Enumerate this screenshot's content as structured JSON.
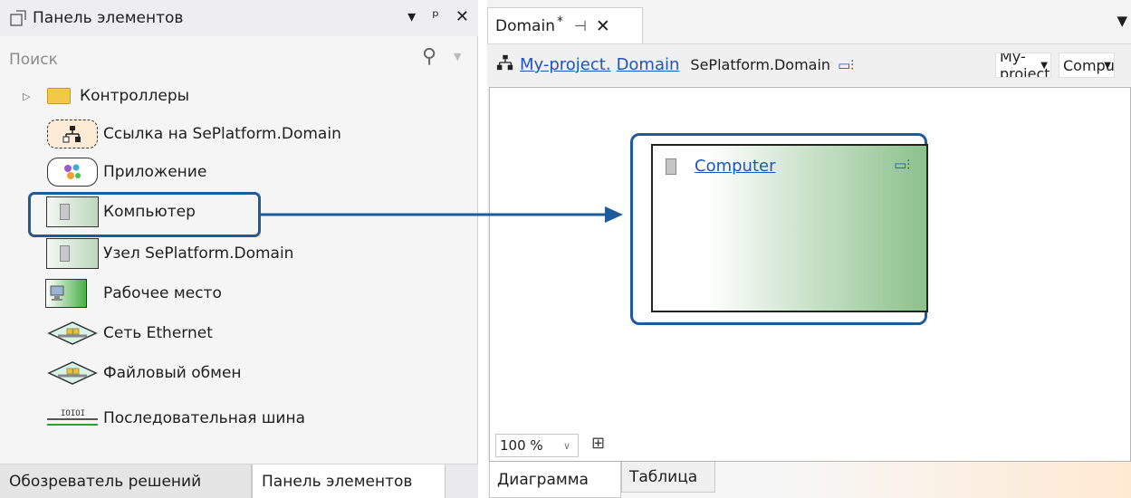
{
  "toolbox": {
    "title": "Панель элементов",
    "pin_glyph": "ᵖ",
    "search_placeholder": "Поиск",
    "items": [
      {
        "label": "Контроллеры"
      },
      {
        "label": "Ссылка на SePlatform.Domain"
      },
      {
        "label": "Приложение"
      },
      {
        "label": "Компьютер"
      },
      {
        "label": "Узел SePlatform.Domain"
      },
      {
        "label": "Рабочее место"
      },
      {
        "label": "Сеть Ethernet"
      },
      {
        "label": "Файловый обмен"
      },
      {
        "label": "Последовательная шина"
      }
    ],
    "tabs": [
      "Обозреватель решений",
      "Панель элементов"
    ],
    "active_tab": "Панель элементов"
  },
  "document": {
    "tab_name": "Domain",
    "modified_mark": "*",
    "breadcrumb": {
      "project_link": "My-project.",
      "domain_link": "Domain",
      "type_label": "SePlatform.Domain"
    },
    "dropdown1_value": "My-project",
    "dropdown2_value": "Computer",
    "node_title": "Computer",
    "zoom": "100 %",
    "bottom_tabs": [
      "Диаграмма",
      "Таблица"
    ],
    "active_bottom_tab": "Диаграмма"
  },
  "colors": {
    "highlight": "#1e5b9c",
    "link": "#1a55c4",
    "node_gradient_end": "#8cc18c"
  }
}
